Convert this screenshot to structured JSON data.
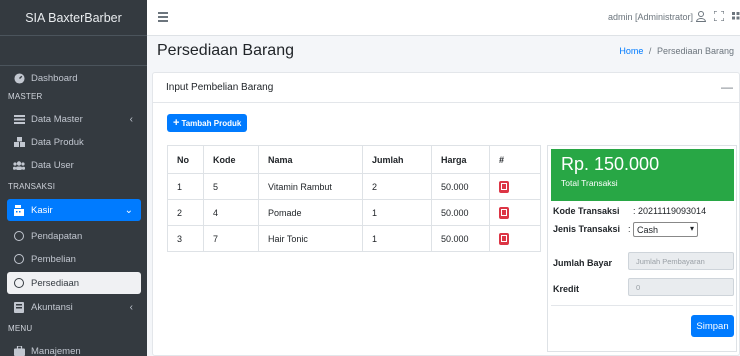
{
  "sidebar": {
    "brand": "SIA BaxterBarber",
    "dashboard": "Dashboard",
    "header_master": "MASTER",
    "data_master": "Data Master",
    "data_produk": "Data Produk",
    "data_user": "Data User",
    "header_transaksi": "TRANSAKSI",
    "kasir": "Kasir",
    "pendapatan": "Pendapatan",
    "pembelian": "Pembelian",
    "persediaan": "Persediaan",
    "akuntansi": "Akuntansi",
    "header_menu": "MENU",
    "manajemen": "Manajemen"
  },
  "topbar": {
    "user": "admin [Administrator]"
  },
  "header": {
    "title": "Persediaan Barang",
    "breadcrumb_home": "Home",
    "breadcrumb_sep": "/",
    "breadcrumb_current": "Persediaan Barang"
  },
  "card": {
    "title": "Input Pembelian Barang",
    "add_button": "Tambah Produk",
    "collapse": "—"
  },
  "table": {
    "headers": [
      "No",
      "Kode",
      "Nama",
      "Jumlah",
      "Harga",
      "#"
    ],
    "rows": [
      [
        "1",
        "5",
        "Vitamin Rambut",
        "2",
        "50.000"
      ],
      [
        "2",
        "4",
        "Pomade",
        "1",
        "50.000"
      ],
      [
        "3",
        "7",
        "Hair Tonic",
        "1",
        "50.000"
      ]
    ]
  },
  "summary": {
    "total": "Rp. 150.000",
    "total_label": "Total Transaksi",
    "kode_label": "Kode Transaksi",
    "kode_value": ": 20211119093014",
    "jenis_label": "Jenis Transaksi",
    "jenis_value": "Cash",
    "jenis_colon": ":",
    "bayar_label": "Jumlah Bayar",
    "bayar_placeholder": "Jumlah Pembayaran",
    "kredit_label": "Kredit",
    "kredit_value": "0",
    "save_button": "Simpan"
  },
  "colors": {
    "sidebar": "#343a40",
    "primary": "#007bff",
    "success": "#28a745",
    "danger": "#dc3545"
  }
}
